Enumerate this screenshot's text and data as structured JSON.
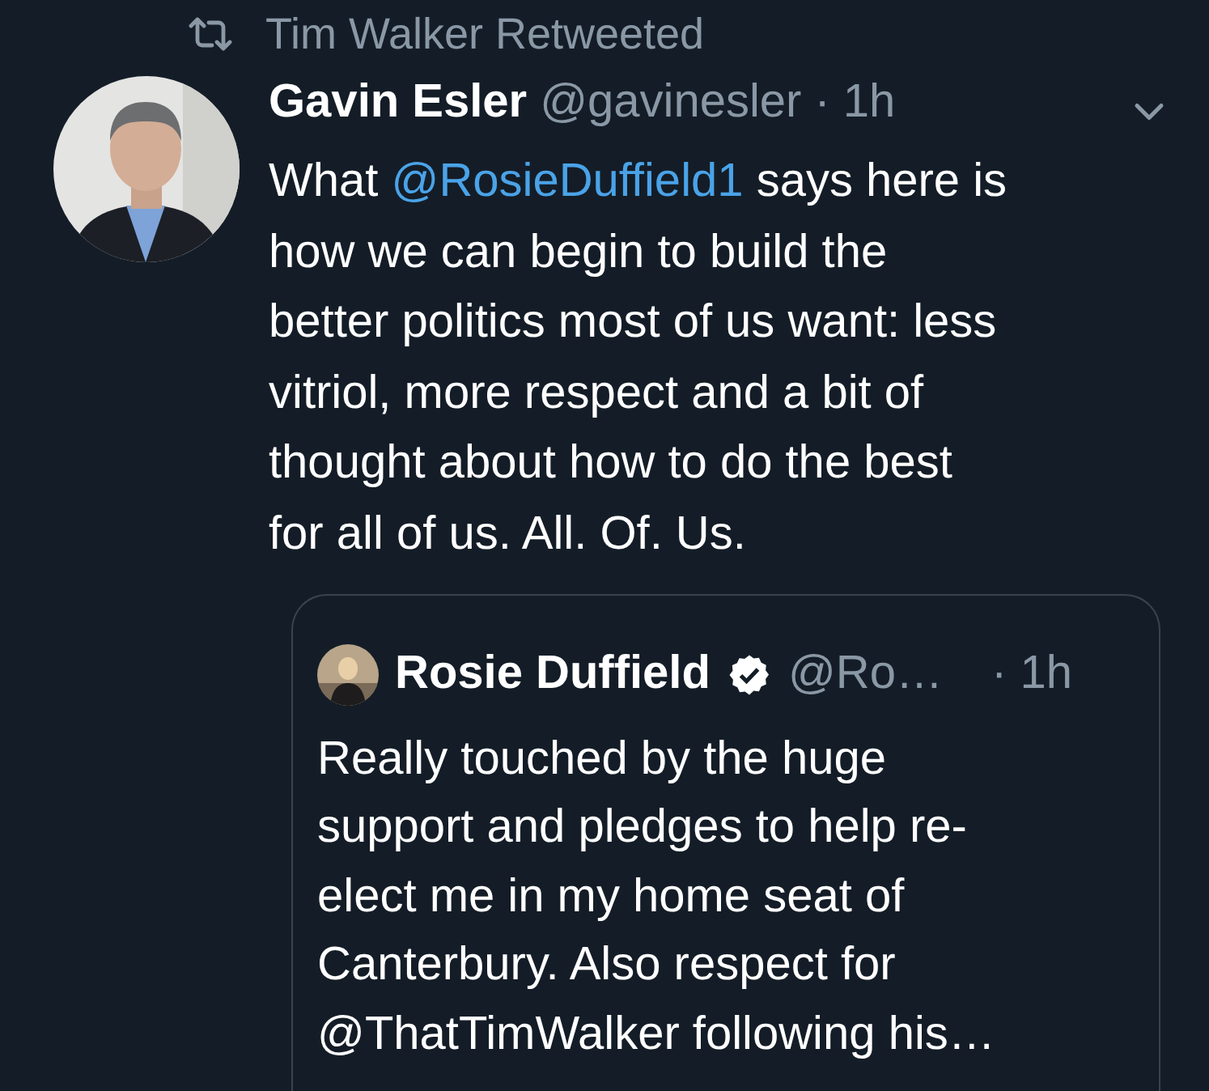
{
  "retweet_banner": {
    "text": "Tim Walker Retweeted"
  },
  "tweet": {
    "author": "Gavin Esler",
    "handle": "@gavinesler",
    "time": "· 1h",
    "body": [
      {
        "kind": "plain",
        "text": "What "
      },
      {
        "kind": "mention",
        "text": "@RosieDuffield1"
      },
      {
        "kind": "plain",
        "text": " says here is\nhow we can begin to build the\nbetter politics most of us want: less\nvitriol, more respect and a bit of\nthought about how to do the best\nfor all of us. All. Of. Us."
      }
    ],
    "quoted": {
      "author": "Rosie Duffield",
      "verified": true,
      "handle": "@Ro…",
      "time": "· 1h",
      "body": "Really touched by the huge\nsupport and pledges to help re-\nelect me in my home seat of\nCanterbury. Also respect for\n@ThatTimWalker following his…"
    }
  }
}
